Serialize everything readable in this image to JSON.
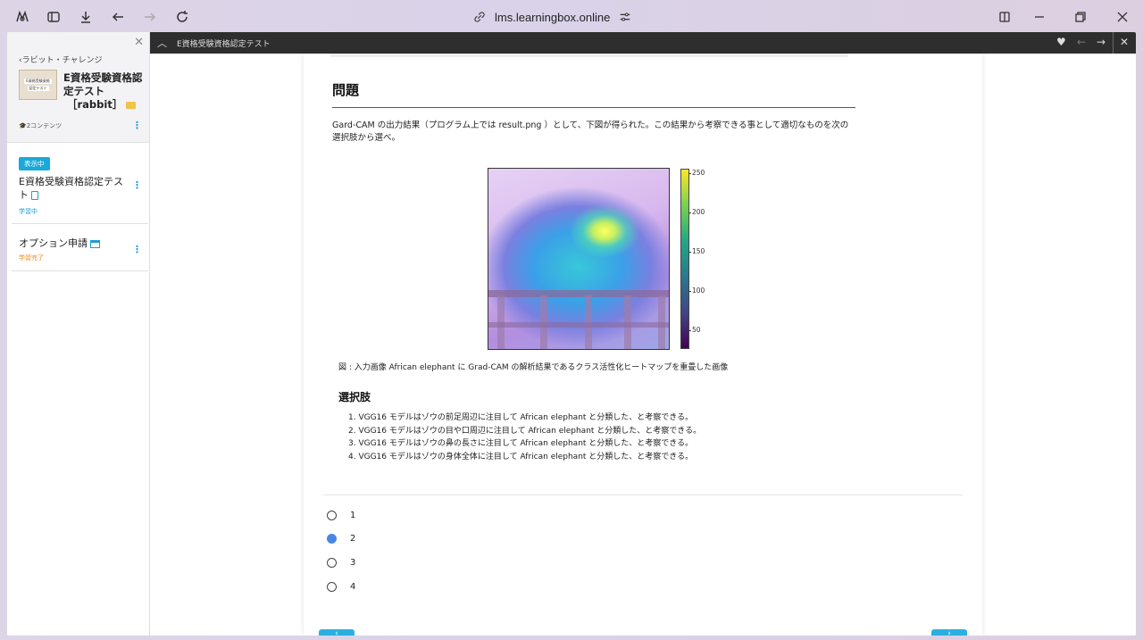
{
  "browser": {
    "url": "lms.learningbox.online"
  },
  "sidebar": {
    "back_label": "‹ラビット・チャレンジ",
    "thumb_lines": [
      "E資格受験資格",
      "認定テスト"
    ],
    "course_title_line1": "E資格受験資格認定テスト",
    "course_title_line2": "［rabbit］",
    "contents_count": "🎓2コンテンツ",
    "items": [
      {
        "badge": "表示中",
        "title": "E資格受験資格認定テスト",
        "status": "学習中"
      },
      {
        "title": "オプション申請",
        "status": "学習完了"
      }
    ]
  },
  "topbar": {
    "title": "E資格受験資格認定テスト"
  },
  "content": {
    "heading": "問題",
    "question": "Gard-CAM の出力結果（プログラム上では result.png ）として、下図が得られた。この結果から考察できる事として適切なものを次の選択肢から選べ。",
    "colorbar_ticks": [
      "250",
      "200",
      "150",
      "100",
      "50"
    ],
    "caption": "図 : 入力画像 African elephant に Grad-CAM の解析結果であるクラス活性化ヒートマップを重畳した画像",
    "choices_heading": "選択肢",
    "choices": [
      "1. VGG16 モデルはゾウの前足周辺に注目して African elephant と分類した、と考察できる。",
      "2. VGG16 モデルはゾウの目や口周辺に注目して African elephant と分類した、と考察できる。",
      "3. VGG16 モデルはゾウの鼻の長さに注目して African elephant と分類した、と考察できる。",
      "4. VGG16 モデルはゾウの身体全体に注目して African elephant と分類した、と考察できる。"
    ],
    "answers": [
      "1",
      "2",
      "3",
      "4"
    ],
    "selected_answer": "2"
  }
}
